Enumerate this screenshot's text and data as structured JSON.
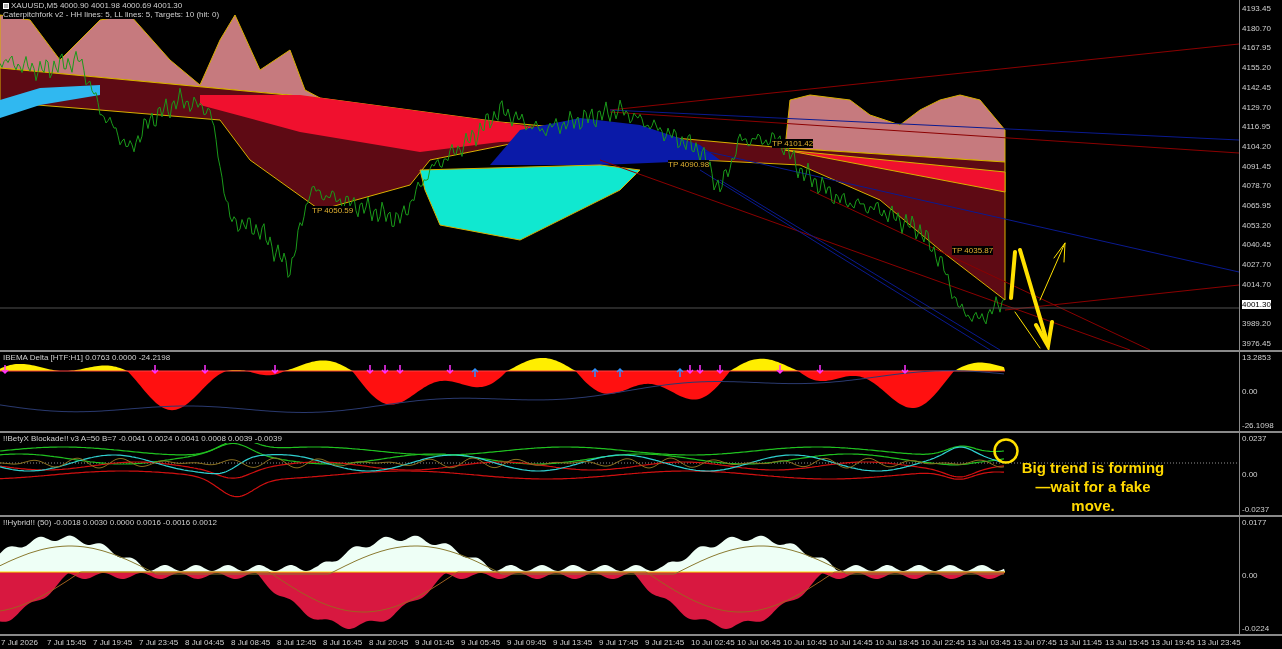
{
  "chart": {
    "symbol_label": "XAUUSD,M5  4000.90 4001.98 4000.69 4001.30",
    "indicator_label": "Caterpitchfork v2 - HH lines: 5, LL lines: 5, Targets: 10 (hit: 0)",
    "target_labels": [
      "TP 4050.59",
      "TP 4090.98",
      "TP 4101.42",
      "TP 4035.87"
    ],
    "price_axis": [
      {
        "text": "4193.45",
        "kind": "tick"
      },
      {
        "text": "4180.70",
        "kind": "tick"
      },
      {
        "text": "4167.95",
        "kind": "tick"
      },
      {
        "text": "4155.20",
        "kind": "tick"
      },
      {
        "text": "4142.45",
        "kind": "tick"
      },
      {
        "text": "4129.70",
        "kind": "tick"
      },
      {
        "text": "4116.95",
        "kind": "tick"
      },
      {
        "text": "4104.20",
        "kind": "tick"
      },
      {
        "text": "4091.45",
        "kind": "tick"
      },
      {
        "text": "4078.70",
        "kind": "tick"
      },
      {
        "text": "4065.95",
        "kind": "tick"
      },
      {
        "text": "4053.20",
        "kind": "tick"
      },
      {
        "text": "4040.45",
        "kind": "tick"
      },
      {
        "text": "4027.70",
        "kind": "tick"
      },
      {
        "text": "4014.70",
        "kind": "tick"
      },
      {
        "text": "4001.30",
        "kind": "current"
      },
      {
        "text": "3989.20",
        "kind": "tick"
      },
      {
        "text": "3976.45",
        "kind": "tick"
      }
    ]
  },
  "indicators": [
    {
      "kind": "delta",
      "label": "IBEMA Delta [HTF:H1] 0.0763 0.0000 -24.2198",
      "axis": [
        "13.2853",
        "0.00",
        "-26.1098"
      ]
    },
    {
      "kind": "blockade",
      "label": "!!BetyX Blockade!! v3 A=50 B=7 -0.0041 0.0024 0.0041 0.0008 0.0039 -0.0039",
      "axis": [
        "0.0237",
        "0.00",
        "-0.0237"
      ]
    },
    {
      "kind": "hybrid",
      "label": "!!Hybrid!! (50) -0.0018 0.0030 0.0000 0.0016 -0.0016 0.0012",
      "axis": [
        "0.0177",
        "0.00",
        "-0.0224"
      ]
    }
  ],
  "time_axis": [
    "7 Jul 2026",
    "7 Jul 15:45",
    "7 Jul 19:45",
    "7 Jul 23:45",
    "8 Jul 04:45",
    "8 Jul 08:45",
    "8 Jul 12:45",
    "8 Jul 16:45",
    "8 Jul 20:45",
    "9 Jul 01:45",
    "9 Jul 05:45",
    "9 Jul 09:45",
    "9 Jul 13:45",
    "9 Jul 17:45",
    "9 Jul 21:45",
    "10 Jul 02:45",
    "10 Jul 06:45",
    "10 Jul 10:45",
    "10 Jul 14:45",
    "10 Jul 18:45",
    "10 Jul 22:45",
    "13 Jul 03:45",
    "13 Jul 07:45",
    "13 Jul 11:45",
    "13 Jul 15:45",
    "13 Jul 19:45",
    "13 Jul 23:45"
  ],
  "annotation": {
    "text": "Big trend is forming—wait for a fake move."
  }
}
